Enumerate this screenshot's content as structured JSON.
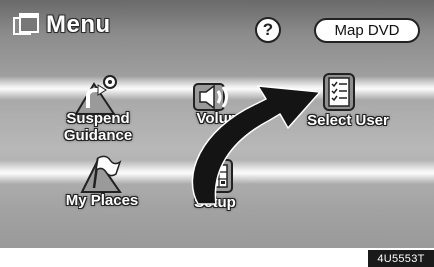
{
  "header": {
    "title": "Menu",
    "title_icon": "menu-windows-icon",
    "help_label": "?",
    "map_dvd_label": "Map DVD"
  },
  "menu_items": [
    {
      "label_line1": "Suspend",
      "label_line2": "Guidance",
      "icon": "suspend-guidance-icon"
    },
    {
      "label_line1": "Volume",
      "label_line2": "",
      "icon": "speaker-icon"
    },
    {
      "label_line1": "Select User",
      "label_line2": "",
      "icon": "clipboard-checklist-icon"
    },
    {
      "label_line1": "My Places",
      "label_line2": "",
      "icon": "flag-icon"
    },
    {
      "label_line1": "Setup",
      "label_line2": "",
      "icon": "setup-grid-icon"
    }
  ],
  "annotation": {
    "icon": "curved-arrow-icon"
  },
  "figure_code": "4U5553T"
}
